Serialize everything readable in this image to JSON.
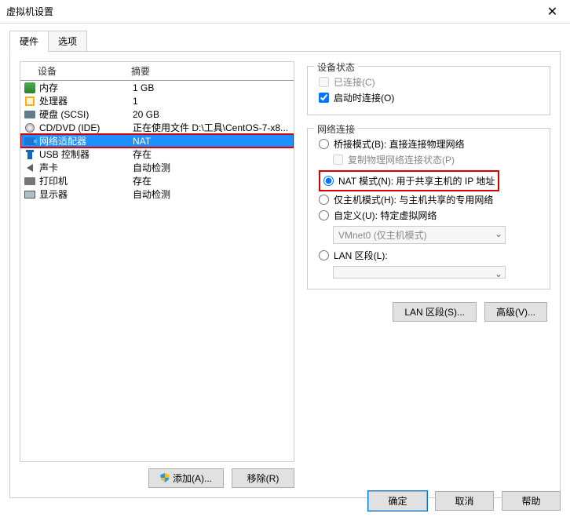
{
  "title": "虚拟机设置",
  "tabs": {
    "hardware": "硬件",
    "options": "选项"
  },
  "table": {
    "device_header": "设备",
    "summary_header": "摘要",
    "rows": [
      {
        "icon": "mem",
        "device": "内存",
        "summary": "1 GB"
      },
      {
        "icon": "cpu",
        "device": "处理器",
        "summary": "1"
      },
      {
        "icon": "hdd",
        "device": "硬盘 (SCSI)",
        "summary": "20 GB"
      },
      {
        "icon": "cd",
        "device": "CD/DVD (IDE)",
        "summary": "正在使用文件 D:\\工具\\CentOS-7-x8..."
      },
      {
        "icon": "net",
        "device": "网络适配器",
        "summary": "NAT",
        "selected": true,
        "hl": true
      },
      {
        "icon": "usb",
        "device": "USB 控制器",
        "summary": "存在"
      },
      {
        "icon": "snd",
        "device": "声卡",
        "summary": "自动检测"
      },
      {
        "icon": "prn",
        "device": "打印机",
        "summary": "存在"
      },
      {
        "icon": "disp",
        "device": "显示器",
        "summary": "自动检测"
      }
    ]
  },
  "left_buttons": {
    "add": "添加(A)...",
    "remove": "移除(R)"
  },
  "device_state": {
    "legend": "设备状态",
    "connected": "已连接(C)",
    "connect_at_startup": "启动时连接(O)"
  },
  "network": {
    "legend": "网络连接",
    "bridged": "桥接模式(B): 直接连接物理网络",
    "replicate": "复制物理网络连接状态(P)",
    "nat": "NAT 模式(N): 用于共享主机的 IP 地址",
    "hostonly": "仅主机模式(H): 与主机共享的专用网络",
    "custom": "自定义(U): 特定虚拟网络",
    "custom_select": "VMnet0 (仅主机模式)",
    "lan_segment": "LAN 区段(L):",
    "lan_select": ""
  },
  "right_buttons": {
    "lan": "LAN 区段(S)...",
    "adv": "高级(V)..."
  },
  "footer": {
    "ok": "确定",
    "cancel": "取消",
    "help": "帮助"
  }
}
